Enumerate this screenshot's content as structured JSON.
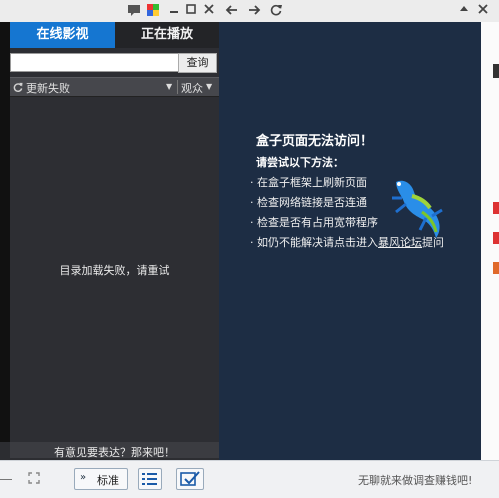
{
  "tabs": {
    "online_label": "在线影视",
    "playing_label": "正在播放"
  },
  "search": {
    "value": "",
    "placeholder": "",
    "button_label": "查询"
  },
  "filter": {
    "refresh_icon": "refresh-icon",
    "current_label": "更新失败",
    "sort_label": "观众"
  },
  "list": {
    "message": "目录加载失败，请重试"
  },
  "feedback": {
    "text": "有意见要表达？那来吧！"
  },
  "error_page": {
    "title": "盒子页面无法访问！",
    "subtitle": "请尝试以下方法：",
    "tips": [
      "· 在盒子框架上刷新页面",
      "· 检查网络链接是否连通",
      "· 检查是否有占用宽带程序"
    ],
    "forum_tip_prefix": "· 如仍不能解决请点击进入",
    "forum_link": "暴风论坛",
    "forum_tip_suffix": "提问"
  },
  "bottom": {
    "standard_label": "标准",
    "message": "无聊就来做调查赚钱吧!"
  },
  "colors": {
    "accent_blue": "#1576d1",
    "content_bg": "#1d2d44",
    "panel_bg": "#2d2e33"
  }
}
